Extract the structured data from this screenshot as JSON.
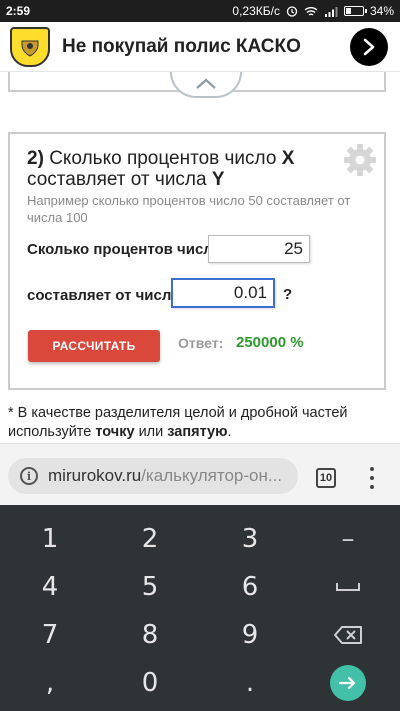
{
  "status_bar": {
    "time": "2:59",
    "network_speed": "0,23КБ/с",
    "battery": "34%"
  },
  "ad": {
    "text": "Не покупай полис КАСКО"
  },
  "card": {
    "number": "2)",
    "title_part1": "Сколько процентов число",
    "var_x": "X",
    "title_part2": "составляет от числа",
    "var_y": "Y",
    "example": "Например сколько процентов число 50 составляет от числа 100",
    "field1_label": "Сколько процентов число",
    "field1_value": "25",
    "field2_label": "составляет от числа",
    "field2_value": "0.01",
    "qmark": "?",
    "calc_button": "РАССЧИТАТЬ",
    "answer_label": "Ответ:",
    "answer_value": "250000 %"
  },
  "note": {
    "part1": "* В качестве разделителя целой и дробной частей используйте",
    "bold1": "точку",
    "part2": "или",
    "bold2": "запятую",
    "part3": "."
  },
  "browser": {
    "url_domain": "mirurokov.ru",
    "url_path": "/калькулятор-он...",
    "tabs_count": "10"
  },
  "keyboard": {
    "keys": [
      "1",
      "2",
      "3",
      "–",
      "4",
      "5",
      "6",
      "␣",
      "7",
      "8",
      "9",
      "⌫",
      ",",
      "0",
      ".",
      "→"
    ]
  }
}
